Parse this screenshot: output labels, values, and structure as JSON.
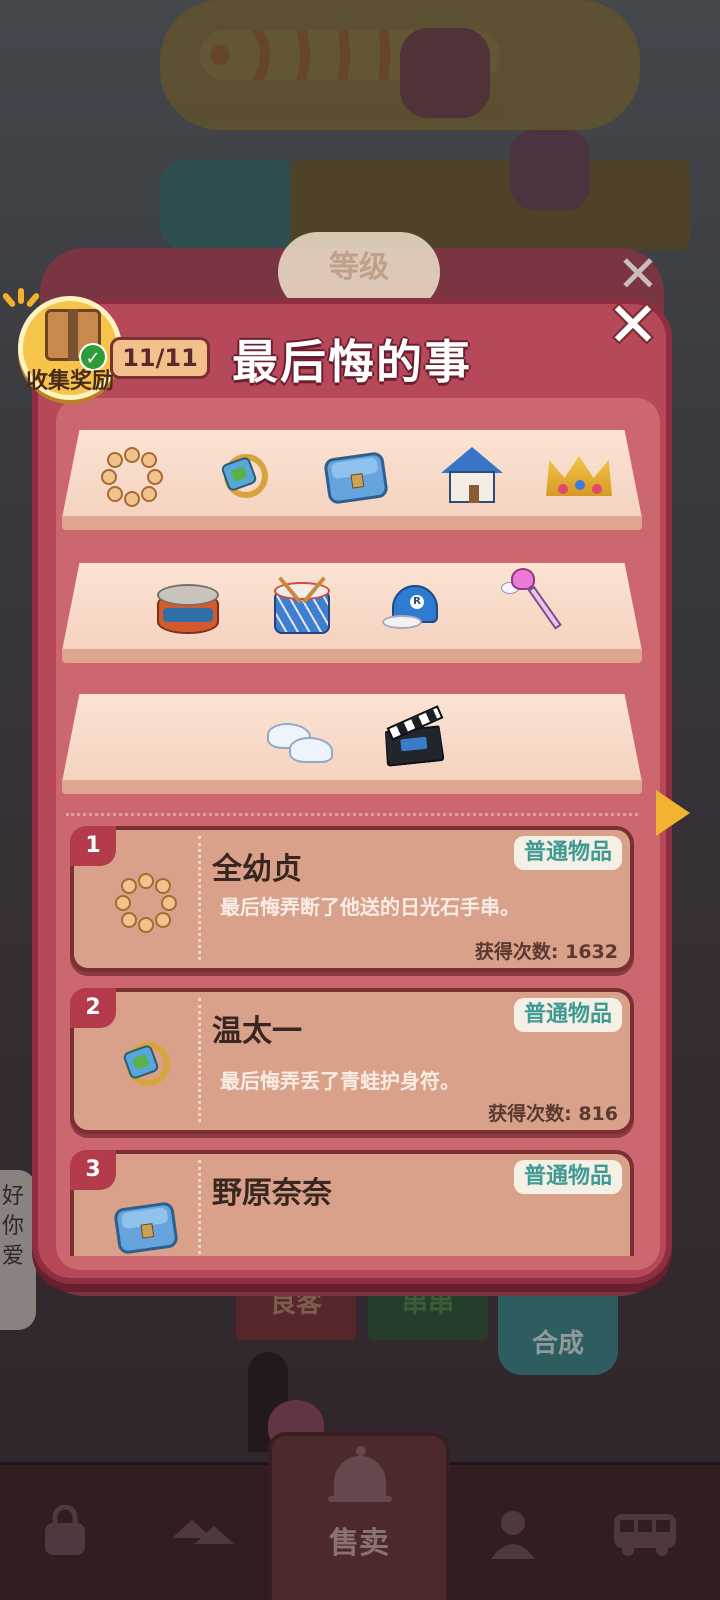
{
  "background": {
    "left_bubble_text": "好你爱",
    "signs": [
      "良客",
      "串串",
      "合成"
    ]
  },
  "panel": {
    "title": "最后悔的事",
    "progress": "11/11",
    "level_tab": "等级",
    "reward_button_label": "收集奖励",
    "close_icon": "close-icon"
  },
  "shelves": [
    [
      "beads-bracelet",
      "frog-charm",
      "blue-bag",
      "blue-house",
      "crown"
    ],
    [
      "tin-can",
      "drum",
      "baseball-cap",
      "magic-wand"
    ],
    [
      "ballet-shoes",
      "clapperboard"
    ]
  ],
  "list": [
    {
      "index": "1",
      "name": "全幼贞",
      "rarity": "普通物品",
      "desc": "最后悔弄断了他送的日光石手串。",
      "count": "获得次数: 1632",
      "icon": "beads-bracelet"
    },
    {
      "index": "2",
      "name": "温太一",
      "rarity": "普通物品",
      "desc": "最后悔弄丢了青蛙护身符。",
      "count": "获得次数: 816",
      "icon": "frog-charm"
    },
    {
      "index": "3",
      "name": "野原奈奈",
      "rarity": "普通物品",
      "desc": "",
      "count": "",
      "icon": "blue-bag"
    }
  ],
  "bottom_nav": {
    "sell_label": "售卖",
    "items": [
      "bag-icon",
      "trade-icon",
      "sell-bell-icon",
      "person-icon",
      "bus-icon"
    ]
  },
  "colors": {
    "panel": "#b7485a",
    "panel_border": "#8d2f40",
    "card": "#d9a08a",
    "badge_text": "#3f9a93",
    "arrow": "#f2b430"
  }
}
